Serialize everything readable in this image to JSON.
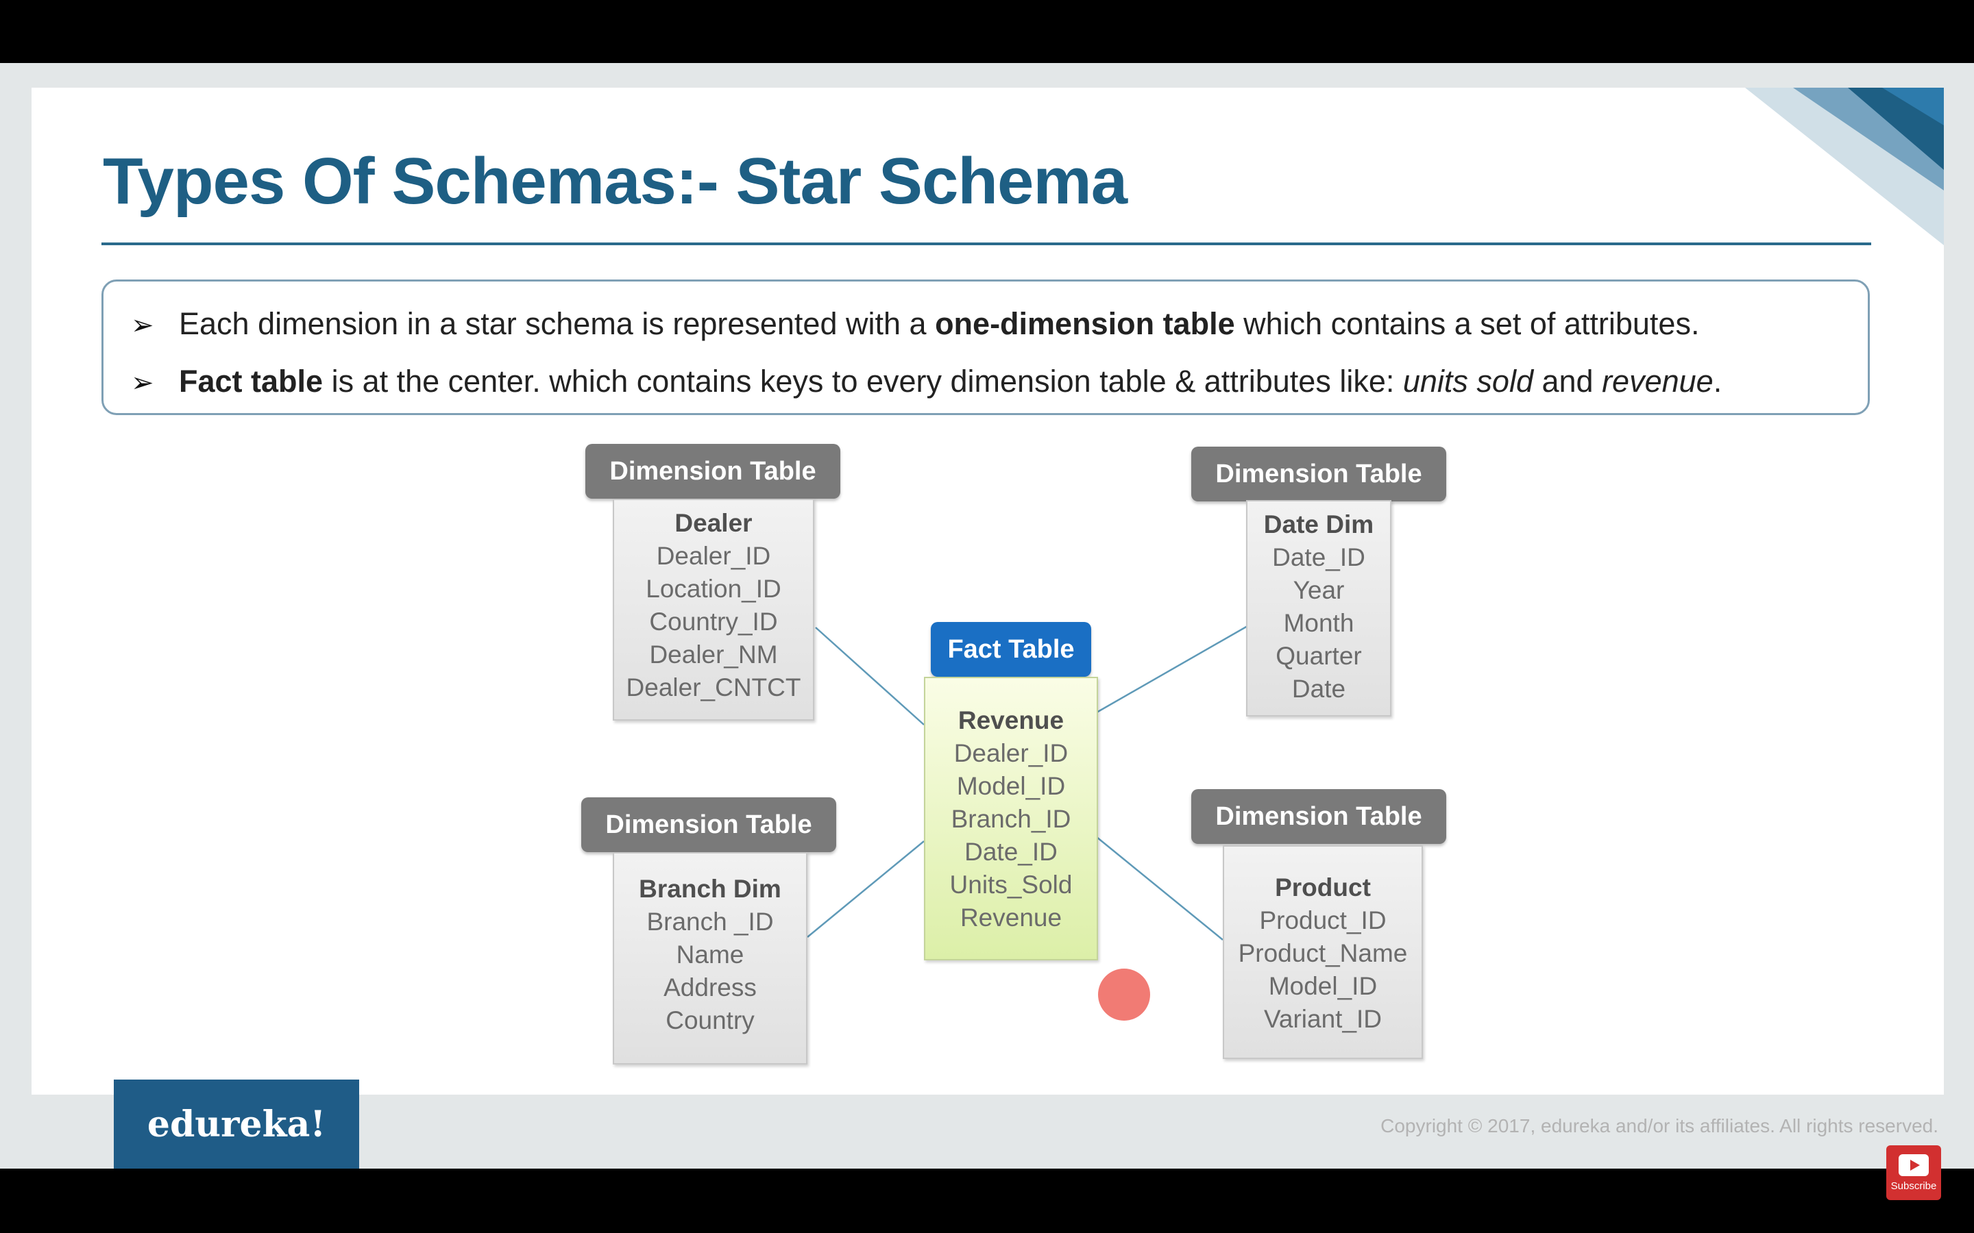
{
  "slide": {
    "title": "Types Of Schemas:- Star Schema",
    "bullets": [
      {
        "marker": "➢",
        "parts": [
          {
            "text": "Each dimension in a star schema is represented with a ",
            "style": "normal"
          },
          {
            "text": "one-dimension table",
            "style": "bold"
          },
          {
            "text": " which contains a set of attributes.",
            "style": "normal"
          }
        ]
      },
      {
        "marker": "➢",
        "parts": [
          {
            "text": "Fact table",
            "style": "bold"
          },
          {
            "text": " is at the center. which contains keys to every dimension table & attributes like: ",
            "style": "normal"
          },
          {
            "text": "units sold",
            "style": "italic"
          },
          {
            "text": " and ",
            "style": "normal"
          },
          {
            "text": "revenue",
            "style": "italic"
          },
          {
            "text": ".",
            "style": "normal"
          }
        ]
      }
    ]
  },
  "diagram": {
    "fact_table": {
      "header": "Fact Table",
      "name": "Revenue",
      "fields": [
        "Dealer_ID",
        "Model_ID",
        "Branch_ID",
        "Date_ID",
        "Units_Sold",
        "Revenue"
      ]
    },
    "dimensions": {
      "dealer": {
        "header": "Dimension Table",
        "name": "Dealer",
        "fields": [
          "Dealer_ID",
          "Location_ID",
          "Country_ID",
          "Dealer_NM",
          "Dealer_CNTCT"
        ]
      },
      "date": {
        "header": "Dimension Table",
        "name": "Date Dim",
        "fields": [
          "Date_ID",
          "Year",
          "Month",
          "Quarter",
          "Date"
        ]
      },
      "branch": {
        "header": "Dimension Table",
        "name": "Branch Dim",
        "fields": [
          "Branch _ID",
          "Name",
          "Address",
          "Country"
        ]
      },
      "product": {
        "header": "Dimension Table",
        "name": "Product",
        "fields": [
          "Product_ID",
          "Product_Name",
          "Model_ID",
          "Variant_ID"
        ]
      }
    }
  },
  "footer": {
    "logo_text": "edureka!",
    "copyright": "Copyright © 2017, edureka and/or its affiliates. All rights reserved."
  },
  "player": {
    "subscribe_label": "Subscribe",
    "subscribe_icon": "youtube-play-icon"
  },
  "colors": {
    "title": "#1e5f84",
    "fact_header": "#1a6fc4",
    "dimension_header": "#7a7a7a",
    "fact_body": "#dcefa8",
    "connector": "#5f9ab8",
    "logo_bg": "#1f5c87",
    "cursor_highlight": "#f07068"
  }
}
